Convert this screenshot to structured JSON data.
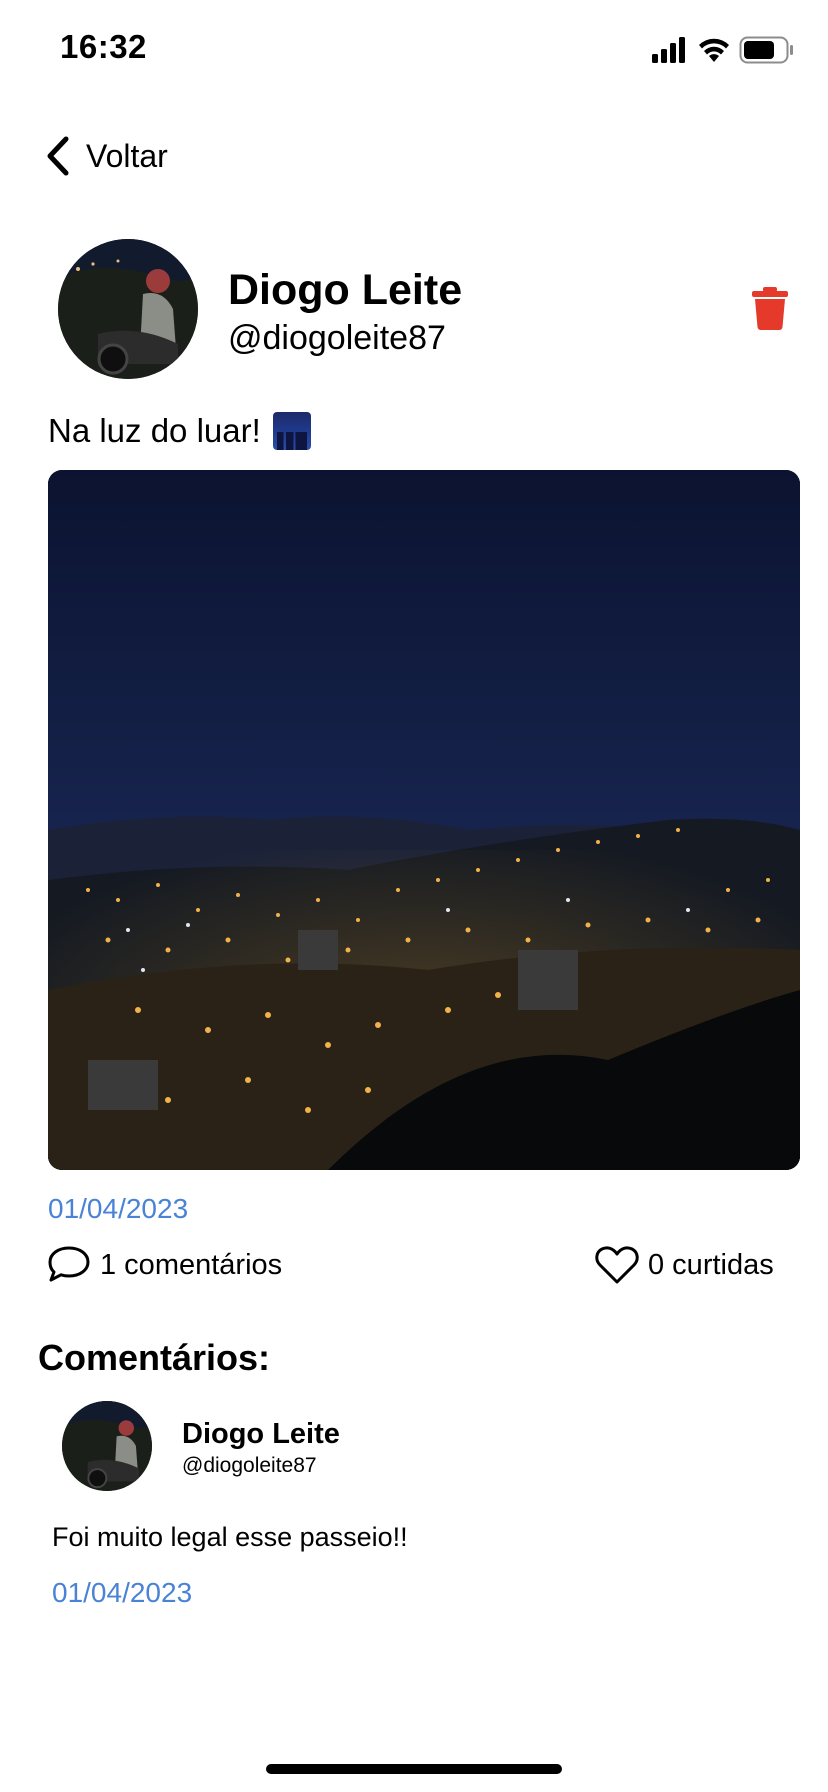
{
  "status_bar": {
    "time": "16:32",
    "icons": [
      "cellular-signal-icon",
      "wifi-icon",
      "battery-icon"
    ]
  },
  "nav": {
    "back_label": "Voltar",
    "back_icon": "chevron-left-icon"
  },
  "post": {
    "author_name": "Diogo Leite",
    "author_handle": "@diogoleite87",
    "caption": "Na luz do luar!",
    "caption_emoji": "night-city-emoji",
    "image": "night city panorama photo",
    "date": "01/04/2023",
    "comments_label": "1 comentários",
    "likes_label": "0 curtidas",
    "delete_icon": "trash-icon"
  },
  "comments_section": {
    "title": "Comentários:",
    "items": [
      {
        "author_name": "Diogo Leite",
        "author_handle": "@diogoleite87",
        "text": "Foi muito legal esse passeio!!",
        "date": "01/04/2023"
      }
    ]
  },
  "colors": {
    "accent_date": "#4a83d6",
    "delete_red": "#e53a2b",
    "text": "#000000",
    "background": "#ffffff"
  }
}
